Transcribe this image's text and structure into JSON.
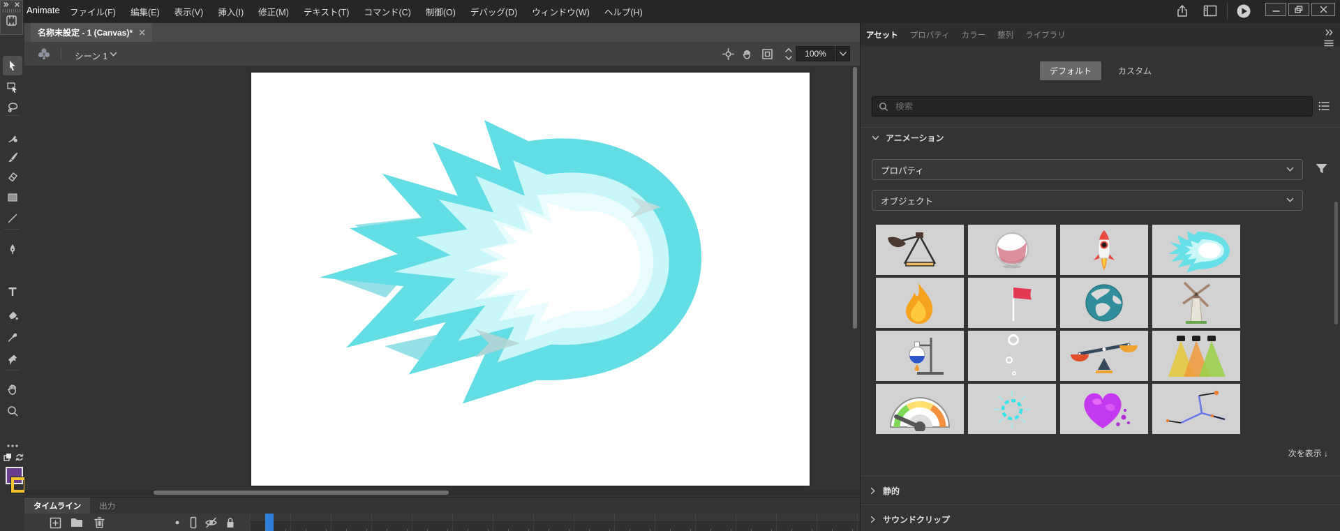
{
  "app": {
    "name": "Animate"
  },
  "menu_bar": {
    "items": [
      "ファイル(F)",
      "編集(E)",
      "表示(V)",
      "挿入(I)",
      "修正(M)",
      "テキスト(T)",
      "コマンド(C)",
      "制御(O)",
      "デバッグ(D)",
      "ウィンドウ(W)",
      "ヘルプ(H)"
    ]
  },
  "document_tabs": {
    "active_title": "名称未設定 - 1 (Canvas)*"
  },
  "scene_bar": {
    "scene_name": "シーン 1",
    "zoom_value": "100%"
  },
  "tools": {
    "names": [
      "selection",
      "subselection",
      "lasso",
      "fluid-brush",
      "classic-brush",
      "eraser",
      "rectangle",
      "line",
      "pen",
      "text",
      "paint-bucket",
      "eyedropper",
      "asset-warp",
      "hand",
      "zoom",
      "more-options"
    ],
    "active": "selection"
  },
  "swatches": {
    "fill_color": "#6a3d8f",
    "stroke_color": "#f2c230"
  },
  "assets_panel": {
    "tabs": [
      {
        "label": "アセット",
        "active": true
      },
      {
        "label": "プロパティ",
        "active": false
      },
      {
        "label": "カラー",
        "active": false
      },
      {
        "label": "整列",
        "active": false
      },
      {
        "label": "ライブラリ",
        "active": false
      }
    ],
    "modes": {
      "default": "デフォルト",
      "custom": "カスタム"
    },
    "search": {
      "placeholder": "検索"
    },
    "sections": {
      "animation": "アニメーション",
      "static": "静的",
      "sound_clips": "サウンドクリップ"
    },
    "dropdowns": {
      "first": "プロパティ",
      "second": "オブジェクト"
    },
    "show_next": "次を表示 ↓",
    "asset_items": [
      "catapult",
      "liquid-glass",
      "rocket",
      "comet-flame",
      "flame",
      "flag",
      "globe",
      "windmill",
      "lab-flask",
      "bubbles",
      "balance-scale",
      "spotlights",
      "gauge",
      "energy-spark",
      "slime-heart",
      "linkage-lines"
    ]
  },
  "timeline_panel": {
    "tabs": [
      {
        "label": "タイムライン",
        "active": true
      },
      {
        "label": "出力",
        "active": false
      }
    ],
    "playhead_color": "#2e80d8"
  },
  "colors": {
    "comet_outer": "#62dde4",
    "comet_mid": "#c9f7f9",
    "comet_inner": "#ffffff",
    "panel_bg": "#333333"
  }
}
